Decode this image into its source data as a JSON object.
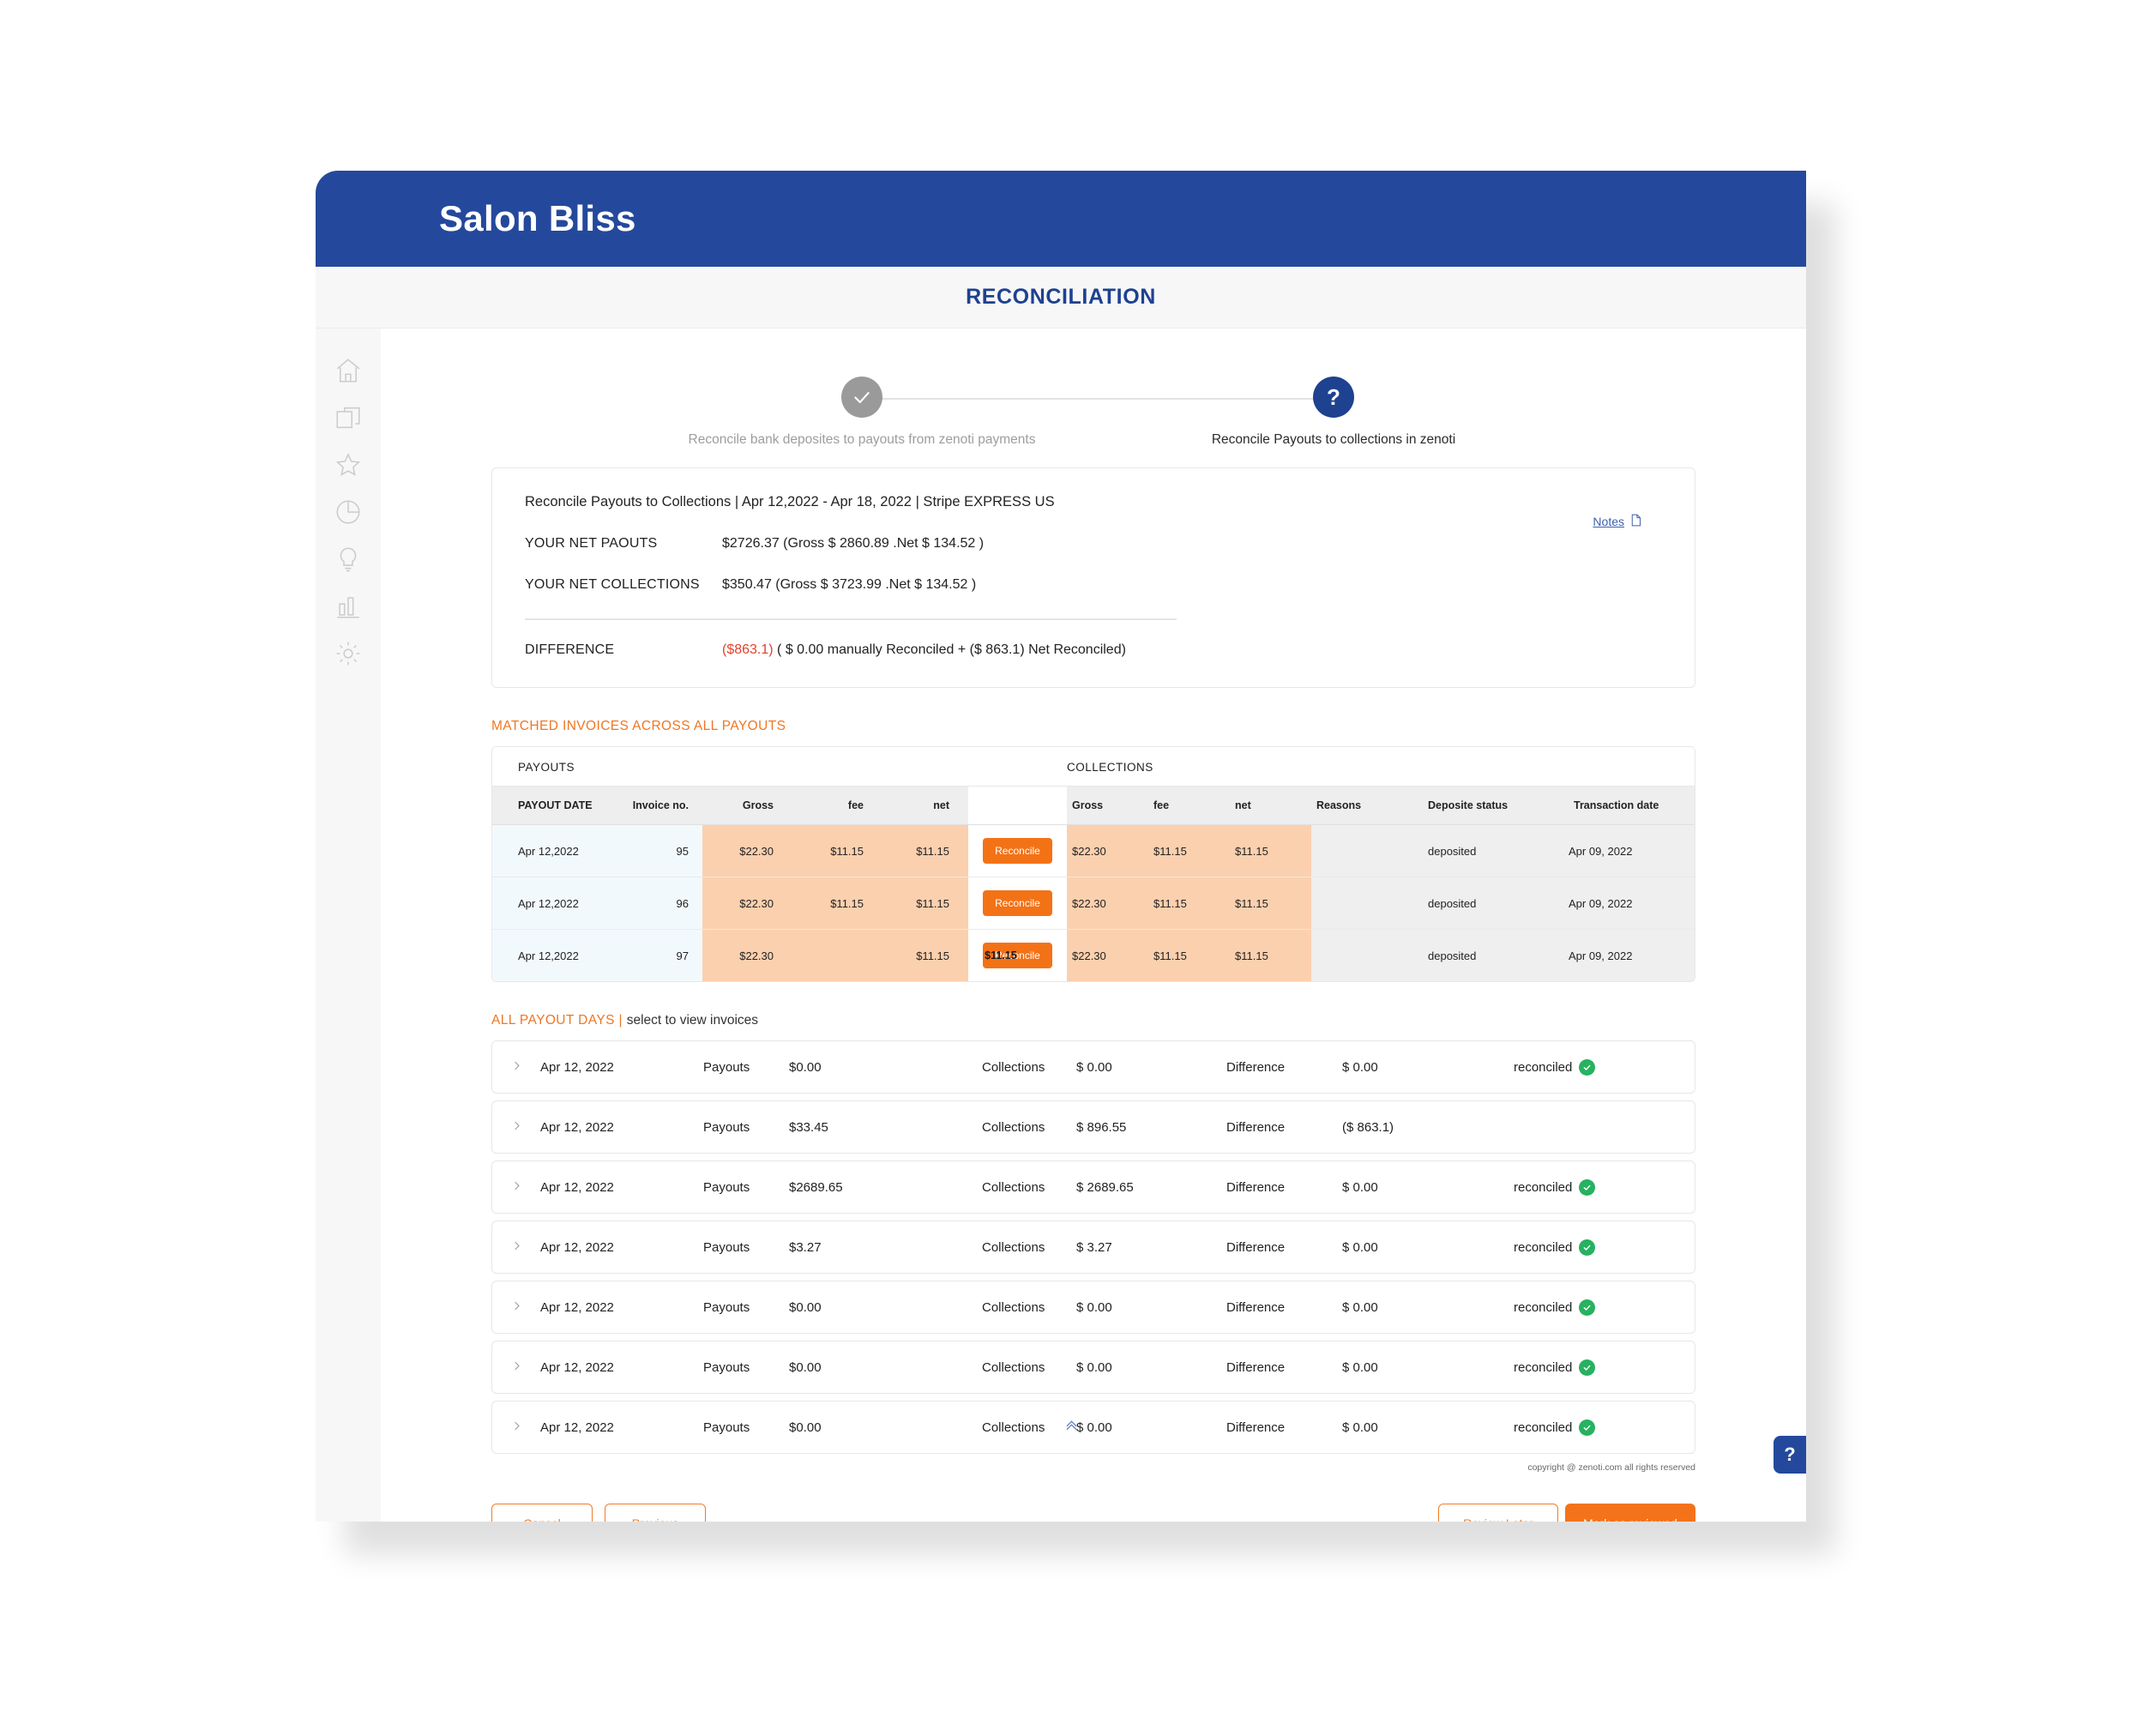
{
  "window": {
    "brand": "Salon Bliss",
    "page_title": "RECONCILIATION"
  },
  "colors": {
    "header_blue": "#24499c",
    "title_blue": "#1e4190",
    "accent_orange": "#ef7622",
    "button_orange": "#f4731a",
    "negative_red": "#e1422a",
    "success_green": "#27b161",
    "row_peach": "#fbd0ae",
    "row_blue": "#f2f9fd"
  },
  "sidebar": {
    "items": [
      {
        "icon": "home-icon"
      },
      {
        "icon": "copy-icon"
      },
      {
        "icon": "star-icon"
      },
      {
        "icon": "pie-chart-icon"
      },
      {
        "icon": "lightbulb-icon"
      },
      {
        "icon": "bar-chart-icon"
      },
      {
        "icon": "gear-icon"
      }
    ]
  },
  "stepper": {
    "steps": [
      {
        "state": "done",
        "glyph": "check-icon",
        "label": "Reconcile bank deposites to payouts from zenoti payments"
      },
      {
        "state": "current",
        "glyph": "?",
        "label": "Reconcile Payouts to collections in zenoti"
      }
    ]
  },
  "summary": {
    "heading": "Reconcile Payouts to Collections | Apr 12,2022 - Apr 18, 2022 | Stripe EXPRESS US",
    "notes_label": "Notes",
    "notes_icon": "document-icon",
    "rows": [
      {
        "label": "YOUR NET PAOUTS",
        "value": "$2726.37 (Gross $ 2860.89 .Net $ 134.52 )"
      },
      {
        "label": "YOUR NET COLLECTIONS",
        "value": "$350.47 (Gross $ 3723.99 .Net $ 134.52 )"
      }
    ],
    "difference": {
      "label": "DIFFERENCE",
      "amount": "($863.1)",
      "detail": "( $ 0.00 manually Reconciled + ($ 863.1) Net Reconciled)"
    }
  },
  "matched": {
    "heading": "MATCHED INVOICES ACROSS ALL PAYOUTS",
    "group_headers": {
      "payouts": "PAYOUTS",
      "collections": "COLLECTIONS"
    },
    "columns": {
      "payout_date": "PAYOUT DATE",
      "invoice_no": "Invoice no.",
      "p_gross": "Gross",
      "p_fee": "fee",
      "p_net": "net",
      "action": "",
      "c_gross": "Gross",
      "c_fee": "fee",
      "c_net": "net",
      "reasons": "Reasons",
      "deposit_status": "Deposite status",
      "transaction_date": "Transaction date"
    },
    "action_label": "Reconcile",
    "rows": [
      {
        "payout_date": "Apr 12,2022",
        "invoice_no": "95",
        "p_gross": "$22.30",
        "p_fee": "$11.15",
        "p_net": "$11.15",
        "action": "Reconcile",
        "overlay_fee": "",
        "c_gross": "$22.30",
        "c_fee": "$11.15",
        "c_net": "$11.15",
        "reasons": "",
        "deposit_status": "deposited",
        "transaction_date": "Apr 09, 2022"
      },
      {
        "payout_date": "Apr 12,2022",
        "invoice_no": "96",
        "p_gross": "$22.30",
        "p_fee": "$11.15",
        "p_net": "$11.15",
        "action": "Reconcile",
        "overlay_fee": "",
        "c_gross": "$22.30",
        "c_fee": "$11.15",
        "c_net": "$11.15",
        "reasons": "",
        "deposit_status": "deposited",
        "transaction_date": "Apr 09, 2022"
      },
      {
        "payout_date": "Apr 12,2022",
        "invoice_no": "97",
        "p_gross": "$22.30",
        "p_fee": "",
        "p_net": "$11.15",
        "action": "Reconcile",
        "overlay_fee": "$11.15",
        "c_gross": "$22.30",
        "c_fee": "$11.15",
        "c_net": "$11.15",
        "reasons": "",
        "deposit_status": "deposited",
        "transaction_date": "Apr 09, 2022"
      }
    ]
  },
  "payout_days": {
    "heading": "ALL PAYOUT DAYS",
    "separator": "|",
    "subheading": "select to view invoices",
    "labels": {
      "payouts": "Payouts",
      "collections": "Collections",
      "difference": "Difference"
    },
    "status_label": "reconciled",
    "rows": [
      {
        "date": "Apr 12, 2022",
        "payouts": "$0.00",
        "collections": "$ 0.00",
        "difference": "$ 0.00",
        "status": "reconciled",
        "cursor": false
      },
      {
        "date": "Apr 12, 2022",
        "payouts": "$33.45",
        "collections": "$ 896.55",
        "difference": "($ 863.1)",
        "status": "",
        "cursor": false
      },
      {
        "date": "Apr 12, 2022",
        "payouts": "$2689.65",
        "collections": "$ 2689.65",
        "difference": "$ 0.00",
        "status": "reconciled",
        "cursor": false
      },
      {
        "date": "Apr 12, 2022",
        "payouts": "$3.27",
        "collections": "$ 3.27",
        "difference": "$ 0.00",
        "status": "reconciled",
        "cursor": false
      },
      {
        "date": "Apr 12, 2022",
        "payouts": "$0.00",
        "collections": "$ 0.00",
        "difference": "$ 0.00",
        "status": "reconciled",
        "cursor": false
      },
      {
        "date": "Apr 12, 2022",
        "payouts": "$0.00",
        "collections": "$ 0.00",
        "difference": "$ 0.00",
        "status": "reconciled",
        "cursor": false
      },
      {
        "date": "Apr 12, 2022",
        "payouts": "$0.00",
        "collections": "$ 0.00",
        "difference": "$ 0.00",
        "status": "reconciled",
        "cursor": true
      }
    ]
  },
  "copyright": "copyright @ zenoti.com all rights reserved",
  "footer": {
    "cancel": "Cancel",
    "previous": "Previous",
    "review_later": "Review Later",
    "mark_reviewed": "Mark as reviewed"
  },
  "help_fab": {
    "glyph": "?"
  }
}
